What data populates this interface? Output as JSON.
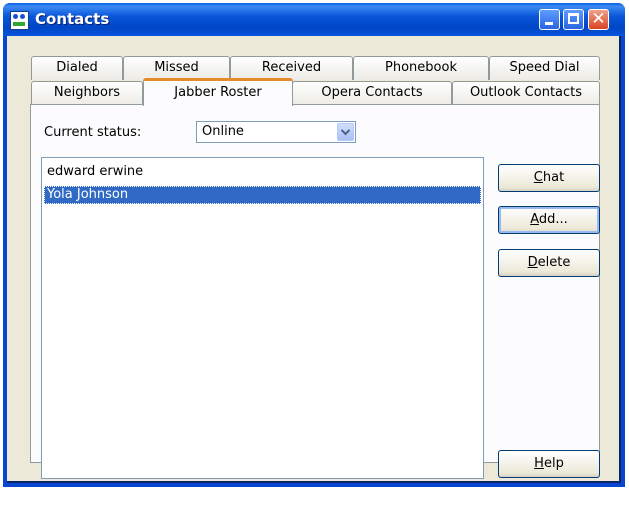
{
  "window": {
    "title": "Contacts"
  },
  "tabs_back": [
    {
      "label": "Dialed"
    },
    {
      "label": "Missed"
    },
    {
      "label": "Received"
    },
    {
      "label": "Phonebook"
    },
    {
      "label": "Speed Dial"
    }
  ],
  "tabs_front": [
    {
      "label": "Neighbors"
    },
    {
      "label": "Jabber Roster",
      "active": true
    },
    {
      "label": "Opera Contacts"
    },
    {
      "label": "Outlook Contacts"
    }
  ],
  "status": {
    "label": "Current status:",
    "value": "Online"
  },
  "roster": [
    {
      "name": "edward erwine",
      "selected": false
    },
    {
      "name": "Yola Johnson",
      "selected": true
    }
  ],
  "buttons": {
    "chat": {
      "mnemonic": "C",
      "rest": "hat"
    },
    "add": {
      "mnemonic": "A",
      "rest": "dd..."
    },
    "delete": {
      "mnemonic": "D",
      "rest": "elete"
    },
    "help": {
      "mnemonic": "H",
      "rest": "elp"
    }
  },
  "colors": {
    "selection": "#316ac5",
    "active_tab_accent": "#e68b2c",
    "titlebar": "#0046c6"
  }
}
